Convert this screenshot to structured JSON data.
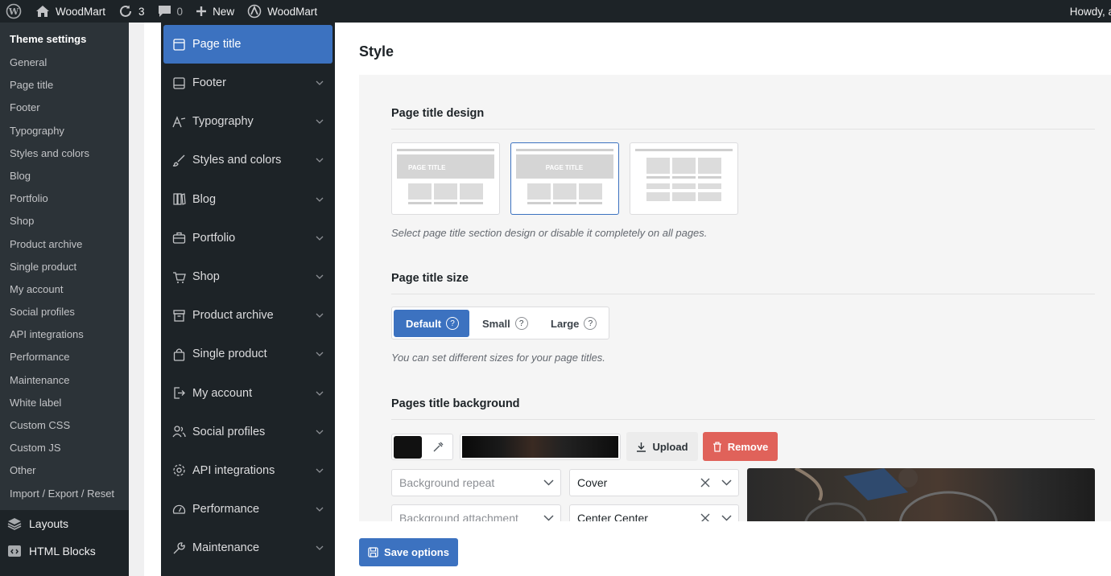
{
  "adminbar": {
    "site_name": "WoodMart",
    "updates_count": "3",
    "comments_count": "0",
    "new_label": "New",
    "theme_label": "WoodMart",
    "howdy": "Howdy, a"
  },
  "wp_menu": {
    "heading": "Theme settings",
    "items": [
      "General",
      "Page title",
      "Footer",
      "Typography",
      "Styles and colors",
      "Blog",
      "Portfolio",
      "Shop",
      "Product archive",
      "Single product",
      "My account",
      "Social profiles",
      "API integrations",
      "Performance",
      "Maintenance",
      "White label",
      "Custom CSS",
      "Custom JS",
      "Other",
      "Import / Export / Reset"
    ],
    "layouts": "Layouts",
    "html_blocks": "HTML Blocks"
  },
  "options_nav": [
    {
      "label": "Page title",
      "icon": "page-title-icon",
      "active": true
    },
    {
      "label": "Footer",
      "icon": "footer-icon"
    },
    {
      "label": "Typography",
      "icon": "typography-icon"
    },
    {
      "label": "Styles and colors",
      "icon": "brush-icon"
    },
    {
      "label": "Blog",
      "icon": "blog-icon"
    },
    {
      "label": "Portfolio",
      "icon": "briefcase-icon"
    },
    {
      "label": "Shop",
      "icon": "cart-icon"
    },
    {
      "label": "Product archive",
      "icon": "archive-icon"
    },
    {
      "label": "Single product",
      "icon": "bag-icon"
    },
    {
      "label": "My account",
      "icon": "account-icon"
    },
    {
      "label": "Social profiles",
      "icon": "users-icon"
    },
    {
      "label": "API integrations",
      "icon": "gear-icon"
    },
    {
      "label": "Performance",
      "icon": "gauge-icon"
    },
    {
      "label": "Maintenance",
      "icon": "wrench-icon"
    }
  ],
  "main": {
    "heading": "Style",
    "design": {
      "title": "Page title design",
      "hint": "Select page title section design or disable it completely on all pages.",
      "thumb_label": "PAGE TITLE",
      "selected": 2
    },
    "size": {
      "title": "Page title size",
      "options": [
        "Default",
        "Small",
        "Large"
      ],
      "selected": "Default",
      "help": "?",
      "hint": "You can set different sizes for your page titles."
    },
    "background": {
      "title": "Pages title background",
      "color": "#111111",
      "upload_label": "Upload",
      "remove_label": "Remove",
      "repeat_placeholder": "Background repeat",
      "size_value": "Cover",
      "attachment_placeholder": "Background attachment",
      "position_value": "Center Center"
    },
    "save_label": "Save options"
  },
  "colors": {
    "accent": "#3c72c0",
    "danger": "#e0625a",
    "admin_bg": "#1d2327"
  }
}
